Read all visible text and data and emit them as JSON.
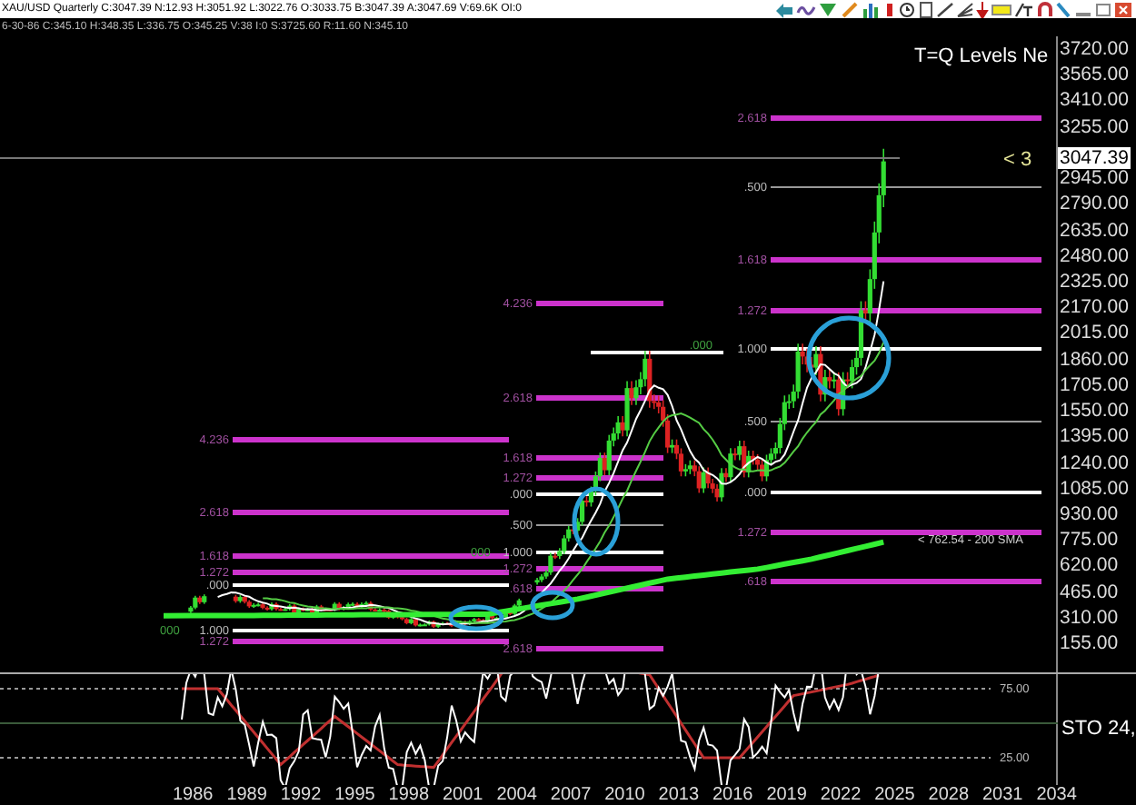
{
  "header": {
    "quote_line": "XAU/USD Quarterly C:3047.39 N:12.93 H:3051.92 L:3022.76 O:3033.75 B:3047.39 A:3047.69 V:69.6K OI:0",
    "bar_line": "6-30-86 C:345.10 H:348.35 L:336.75 O:345.25 V:38 I:0 S:3725.60 R:11.60 N:345.10"
  },
  "chart": {
    "title": "T=Q Levels Ne",
    "price_axis": [
      "3720.00",
      "3565.00",
      "3410.00",
      "3255.00",
      "2945.00",
      "2790.00",
      "2635.00",
      "2480.00",
      "2325.00",
      "2170.00",
      "2015.00",
      "1860.00",
      "1705.00",
      "1550.00",
      "1395.00",
      "1240.00",
      "1085.00",
      "930.00",
      "775.00",
      "620.00",
      "465.00",
      "310.00",
      "155.00"
    ],
    "last_price": "3047.39",
    "last_price_tag": "< 3",
    "sma_label": "< 762.54 - 200 SMA",
    "levels": [
      {
        "label": "2.618",
        "kind": "fib"
      },
      {
        "label": ".500",
        "kind": "mid"
      },
      {
        "label": "1.618",
        "kind": "fib"
      },
      {
        "label": "1.272",
        "kind": "fib"
      },
      {
        "label": "1.000",
        "kind": "range"
      },
      {
        "label": ".500",
        "kind": "mid"
      },
      {
        "label": ".000",
        "kind": "range"
      },
      {
        "label": "1.272",
        "kind": "fib"
      },
      {
        "label": ".618",
        "kind": "fib"
      },
      {
        "label": "4.236",
        "kind": "fib"
      },
      {
        "label": ".000",
        "kind": "range"
      },
      {
        "label": "2.618",
        "kind": "fib"
      },
      {
        "label": "1.618",
        "kind": "fib"
      },
      {
        "label": "1.272",
        "kind": "fib"
      },
      {
        "label": ".000",
        "kind": "range"
      },
      {
        "label": ".500",
        "kind": "mid"
      },
      {
        "label": "1.000",
        "kind": "range"
      },
      {
        "label": "1.272",
        "kind": "fib"
      },
      {
        "label": ".618",
        "kind": "fib"
      },
      {
        "label": "2.618",
        "kind": "fib"
      },
      {
        "label": "4.236",
        "kind": "fib"
      },
      {
        "label": "2.618",
        "kind": "fib"
      },
      {
        "label": "1.618",
        "kind": "fib"
      },
      {
        "label": "1.272",
        "kind": "fib"
      },
      {
        "label": ".000",
        "kind": "range"
      },
      {
        "label": "1.000",
        "kind": "range"
      },
      {
        "label": "1.272",
        "kind": "fib"
      },
      {
        "label": "000",
        "kind": "tag"
      },
      {
        "label": "000",
        "kind": "tag"
      }
    ]
  },
  "oscillator": {
    "levels": [
      "75.00",
      "25.00"
    ],
    "label": "STO 24,"
  },
  "time_axis": [
    "1986",
    "1989",
    "1992",
    "1995",
    "1998",
    "2001",
    "2004",
    "2007",
    "2010",
    "2013",
    "2016",
    "2019",
    "2022",
    "2025",
    "2028",
    "2031",
    "2034"
  ]
}
